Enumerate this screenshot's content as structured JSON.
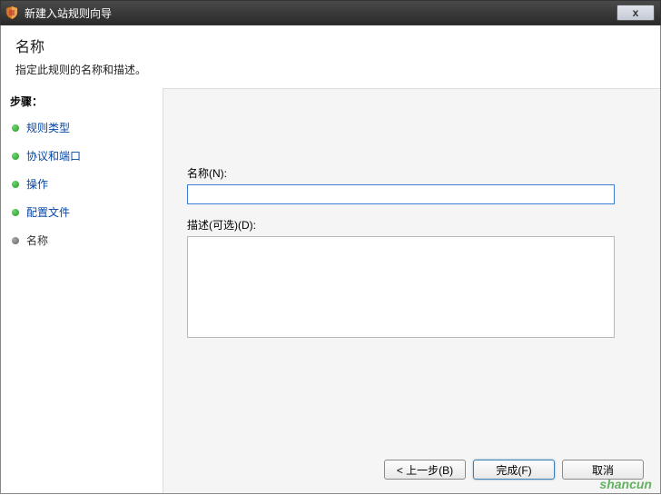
{
  "titlebar": {
    "title": "新建入站规则向导",
    "close_label": "x"
  },
  "header": {
    "title": "名称",
    "subtitle": "指定此规则的名称和描述。"
  },
  "sidebar": {
    "steps_label": "步骤：",
    "items": [
      {
        "label": "规则类型",
        "current": false
      },
      {
        "label": "协议和端口",
        "current": false
      },
      {
        "label": "操作",
        "current": false
      },
      {
        "label": "配置文件",
        "current": false
      },
      {
        "label": "名称",
        "current": true
      }
    ]
  },
  "form": {
    "name_label": "名称(N):",
    "name_value": "",
    "desc_label": "描述(可选)(D):",
    "desc_value": ""
  },
  "buttons": {
    "back": "< 上一步(B)",
    "finish": "完成(F)",
    "cancel": "取消"
  },
  "watermark": "shancun"
}
